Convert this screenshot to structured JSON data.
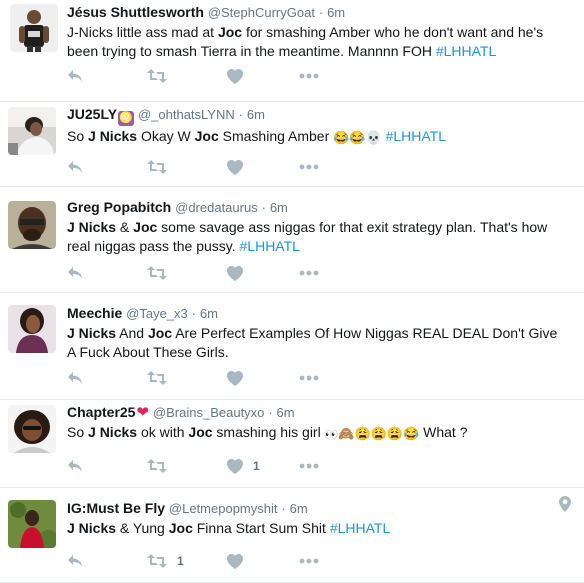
{
  "tweets": [
    {
      "name": "Jésus Shuttlesworth",
      "handle": "@StephCurryGoat",
      "sep": "·",
      "time": "6m",
      "segments": [
        {
          "t": "J-Nicks little ass mad at "
        },
        {
          "t": "Joc",
          "b": true
        },
        {
          "t": " for smashing Amber who he don't want and he's been trying to smash Tierra in the meantime. Mannnn FOH "
        },
        {
          "t": "#LHHATL",
          "h": true
        }
      ],
      "retweets": "",
      "likes": "",
      "geo": false
    },
    {
      "name": "JU25LY",
      "badge": "♌",
      "handle": "@_ohthatsLYNN",
      "sep": "·",
      "time": "6m",
      "segments": [
        {
          "t": "So "
        },
        {
          "t": "J Nicks",
          "b": true
        },
        {
          "t": " Okay W "
        },
        {
          "t": "Joc",
          "b": true
        },
        {
          "t": " Smashing Amber "
        },
        {
          "e": "😂",
          "c": "e-laugh"
        },
        {
          "e": "😂",
          "c": "e-laugh"
        },
        {
          "e": "💀",
          "c": "e-skull"
        },
        {
          "t": " "
        },
        {
          "t": "#LHHATL",
          "h": true
        }
      ],
      "retweets": "",
      "likes": "",
      "geo": false
    },
    {
      "name": "Greg Popabitch",
      "handle": "@dredataurus",
      "sep": "·",
      "time": "6m",
      "segments": [
        {
          "t": "J Nicks",
          "b": true
        },
        {
          "t": " & "
        },
        {
          "t": "Joc",
          "b": true
        },
        {
          "t": " some savage ass niggas for that exit strategy plan. That's how real niggas pass the pussy. "
        },
        {
          "t": "#LHHATL",
          "h": true
        }
      ],
      "retweets": "",
      "likes": "",
      "geo": false
    },
    {
      "name": "Meechie",
      "handle": "@Taye_x3",
      "sep": "·",
      "time": "6m",
      "segments": [
        {
          "t": "J Nicks",
          "b": true
        },
        {
          "t": " And "
        },
        {
          "t": "Joc",
          "b": true
        },
        {
          "t": " Are Perfect Examples Of How Niggas REAL DEAL Don't Give A Fuck About These Girls."
        }
      ],
      "retweets": "",
      "likes": "",
      "geo": false
    },
    {
      "name": "Chapter25",
      "heart": "❤",
      "handle": "@Brains_Beautyxo",
      "sep": "·",
      "time": "6m",
      "segments": [
        {
          "t": "So  "
        },
        {
          "t": "J Nicks",
          "b": true
        },
        {
          "t": " ok with "
        },
        {
          "t": "Joc",
          "b": true
        },
        {
          "t": " smashing his girl "
        },
        {
          "e": "👀",
          "c": "e-eyes"
        },
        {
          "e": "🙈",
          "c": "e-monkey"
        },
        {
          "e": "😩",
          "c": "e-weary"
        },
        {
          "e": "😩",
          "c": "e-weary"
        },
        {
          "e": "😩",
          "c": "e-weary"
        },
        {
          "e": "😂",
          "c": "e-laugh"
        },
        {
          "t": " What ?"
        }
      ],
      "retweets": "",
      "likes": "1",
      "geo": false
    },
    {
      "name": "IG:Must Be Fly",
      "handle": "@Letmepopmyshit",
      "sep": "·",
      "time": "6m",
      "segments": [
        {
          "t": "J Nicks",
          "b": true
        },
        {
          "t": " & Yung "
        },
        {
          "t": "Joc",
          "b": true
        },
        {
          "t": " Finna Start Sum Shit "
        },
        {
          "t": "#LHHATL",
          "h": true
        }
      ],
      "retweets": "1",
      "likes": "",
      "geo": true
    }
  ],
  "icons": {
    "reply": "reply-icon",
    "retweet": "retweet-icon",
    "like": "heart-icon",
    "more": "more-dots-icon",
    "geo": "location-pin-icon"
  },
  "colors": {
    "hashtag": "#1b95e0",
    "secondary": "#657786",
    "action": "#aab8c2",
    "divider": "#e6ecf0"
  }
}
